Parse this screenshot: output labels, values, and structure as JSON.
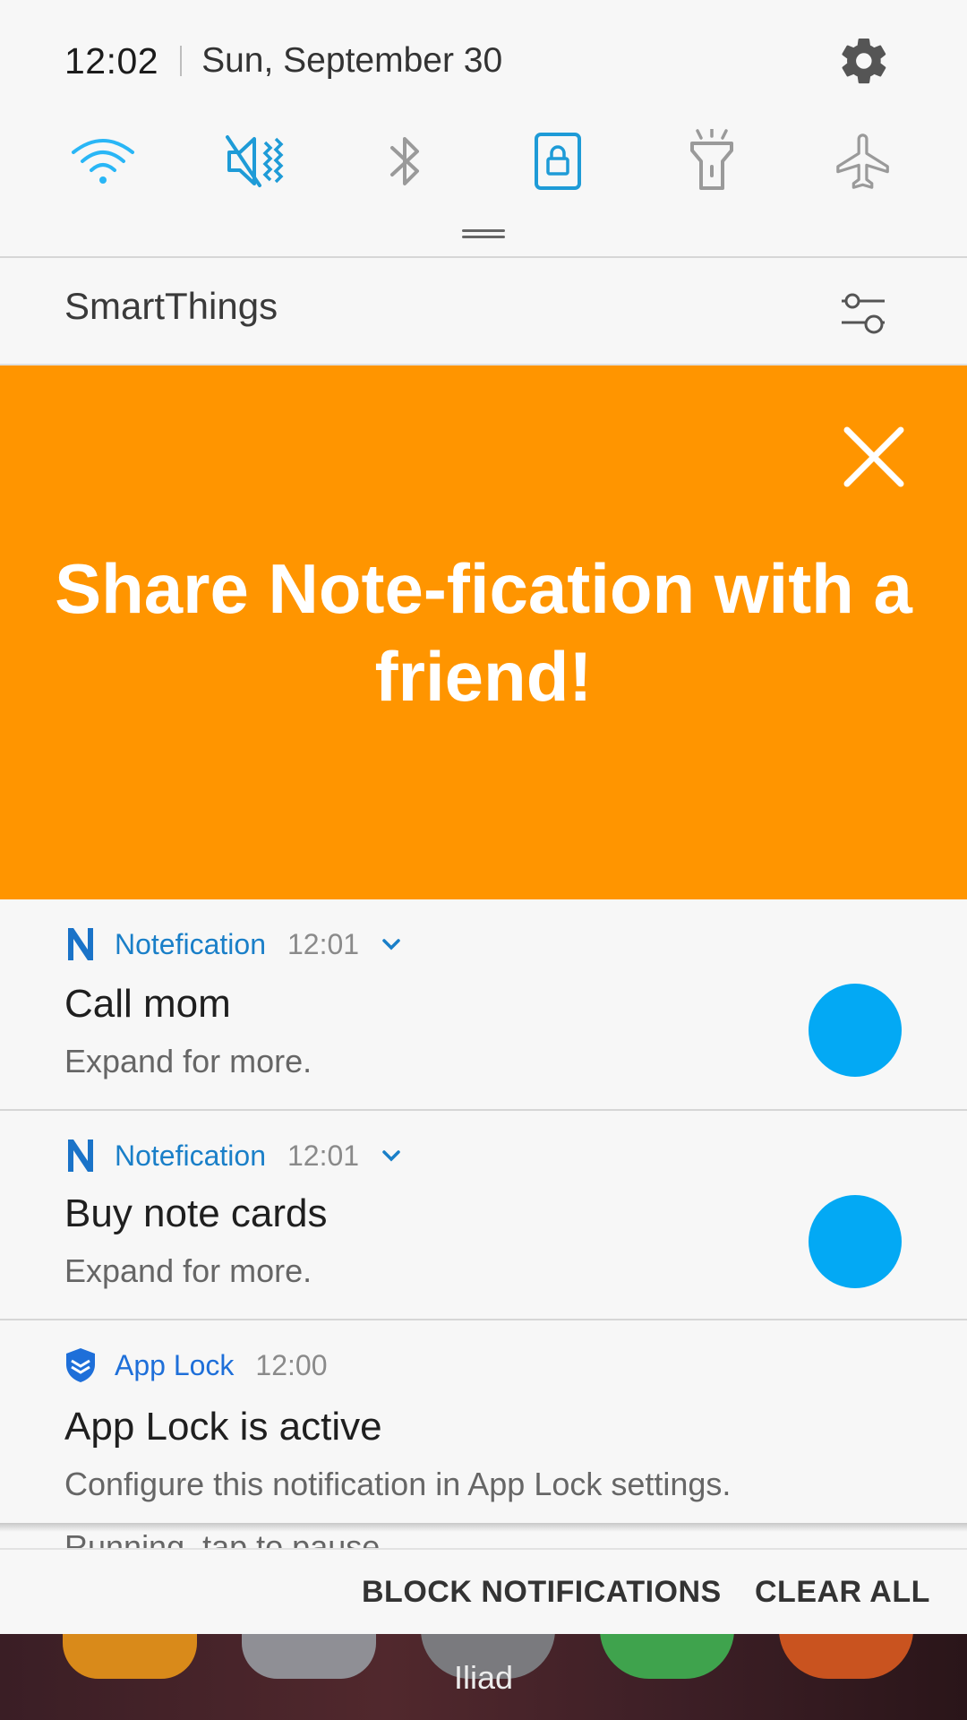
{
  "status": {
    "time": "12:02",
    "date": "Sun, September 30"
  },
  "quick_settings": [
    "wifi-icon",
    "mute-icon",
    "bluetooth-icon",
    "screen-lock-icon",
    "flashlight-icon",
    "airplane-icon"
  ],
  "smartthings": {
    "label": "SmartThings"
  },
  "banner": {
    "text": "Share Note-fication with a friend!",
    "color": "#ff9500"
  },
  "notifications": [
    {
      "app": "Notefication",
      "time": "12:01",
      "title": "Call mom",
      "body": "Expand for more."
    },
    {
      "app": "Notefication",
      "time": "12:01",
      "title": "Buy note cards",
      "body": "Expand for more."
    },
    {
      "app": "App Lock",
      "time": "12:00",
      "title": "App Lock is active",
      "body": "Configure this notification in App Lock settings."
    }
  ],
  "partial_notification": {
    "text": "Running, tap to pause"
  },
  "actions": {
    "block": "BLOCK NOTIFICATIONS",
    "clear": "CLEAR ALL"
  },
  "home": {
    "label": "Iliad"
  },
  "colors": {
    "accent": "#1a8fe0",
    "dot": "#03a9f4",
    "banner": "#ff9500"
  }
}
